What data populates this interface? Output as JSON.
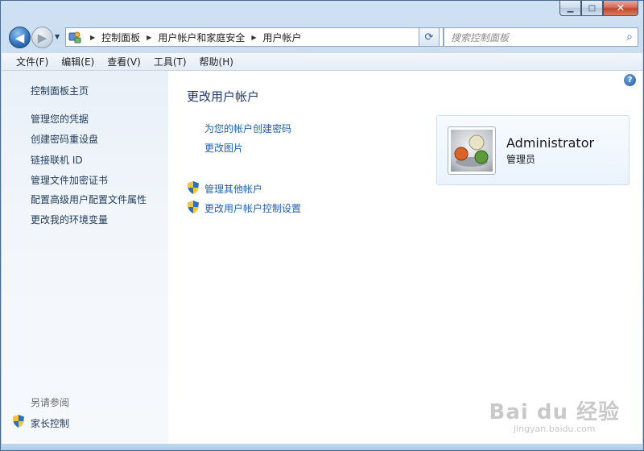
{
  "window": {
    "caption_buttons": [
      {
        "name": "minimize-button",
        "glyph": "▁"
      },
      {
        "name": "maximize-button",
        "glyph": "□"
      },
      {
        "name": "close-button",
        "glyph": "✕"
      }
    ]
  },
  "nav": {
    "back_glyph": "◀",
    "forward_glyph": "▶",
    "recent_glyph": "▼",
    "breadcrumbs": [
      "控制面板",
      "用户帐户和家庭安全",
      "用户帐户"
    ],
    "crumb_separator": "▶",
    "dropdown_glyph": "▼",
    "refresh_glyph": "⟳",
    "search_placeholder": "搜索控制面板",
    "search_glyph": "⌕"
  },
  "menubar": {
    "items": [
      "文件(F)",
      "编辑(E)",
      "查看(V)",
      "工具(T)",
      "帮助(H)"
    ]
  },
  "sidebar": {
    "home_link": "控制面板主页",
    "links": [
      "管理您的凭据",
      "创建密码重设盘",
      "链接联机 ID",
      "管理文件加密证书",
      "配置高级用户配置文件属性",
      "更改我的环境变量"
    ],
    "see_also_title": "另请参阅",
    "see_also_link": "家长控制"
  },
  "main": {
    "help_glyph": "?",
    "page_title": "更改用户帐户",
    "tasks": [
      "为您的帐户创建密码",
      "更改图片"
    ],
    "admin_tasks": [
      "管理其他帐户",
      "更改用户帐户控制设置"
    ]
  },
  "user": {
    "name": "Administrator",
    "role": "管理员"
  },
  "watermark": {
    "main": "Bai du 经验",
    "sub": "jingyan.baidu.com"
  },
  "colors": {
    "link": "#1f5fb0",
    "title": "#1e3a6e",
    "sidebar_bg": "#eef4fa",
    "frame": "#b9d3ec"
  }
}
